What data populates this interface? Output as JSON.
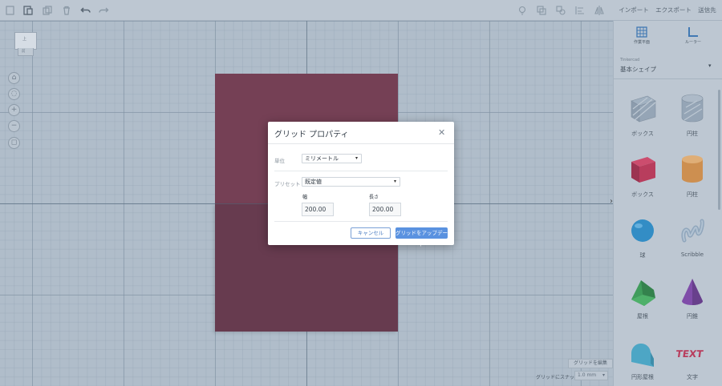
{
  "topnav": {
    "import_label": "インポート",
    "export_label": "エクスポート",
    "send_label": "送信先"
  },
  "panel": {
    "workplane_label": "作業平面",
    "ruler_label": "ルーラー",
    "library_source": "Tinkercad",
    "library_name": "基本シェイプ",
    "shapes": [
      {
        "name": "ボックス",
        "icon": "box-hole-icon"
      },
      {
        "name": "円柱",
        "icon": "cylinder-hole-icon"
      },
      {
        "name": "ボックス",
        "icon": "box-icon"
      },
      {
        "name": "円柱",
        "icon": "cylinder-icon"
      },
      {
        "name": "球",
        "icon": "sphere-icon"
      },
      {
        "name": "Scribble",
        "icon": "scribble-icon"
      },
      {
        "name": "屋根",
        "icon": "roof-icon"
      },
      {
        "name": "円錐",
        "icon": "cone-icon"
      },
      {
        "name": "円形屋根",
        "icon": "round-roof-icon"
      },
      {
        "name": "文字",
        "icon": "text-icon"
      }
    ]
  },
  "workplane": {
    "edit_grid_label": "グリッドを編集",
    "snap_label": "グリッドにスナップ",
    "snap_value": "1.0 mm"
  },
  "viewcube": {
    "top_label": "上",
    "front_label": "前"
  },
  "dialog": {
    "title": "グリッド プロパティ",
    "units_label": "単位",
    "units_value": "ミリメートル",
    "preset_label": "プリセット",
    "preset_value": "既定値",
    "width_label": "幅",
    "width_value": "200.00",
    "length_label": "長さ",
    "length_value": "200.00",
    "cancel_label": "キャンセル",
    "update_label": "グリッドをアップデート"
  },
  "colors": {
    "shape": "#6e2a40",
    "primary_button": "#5a92e0",
    "box_red": "#c0264a",
    "cylinder_orange": "#d98a3a",
    "sphere_blue": "#1e88c8",
    "roof_green": "#2e9a48",
    "cone_purple": "#7a3aa6",
    "round_roof_teal": "#3ea6c8"
  }
}
